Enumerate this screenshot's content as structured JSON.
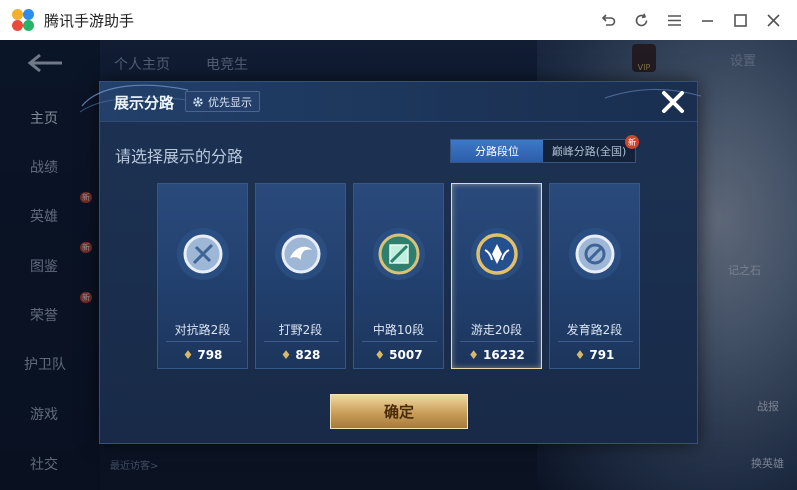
{
  "window": {
    "title": "腾讯手游助手",
    "controls": [
      "undo-icon",
      "refresh-icon",
      "menu-icon",
      "minimize-icon",
      "maximize-icon",
      "close-icon"
    ]
  },
  "background": {
    "tabs": [
      "个人主页",
      "电竞生"
    ],
    "settings_label": "设置",
    "vip_label": "VIP",
    "sidebar": [
      "主页",
      "战绩",
      "英雄",
      "图鉴",
      "荣誉",
      "护卫队",
      "游戏",
      "社交"
    ],
    "sidebar_new_badge": "新",
    "recent_visitors": "最近访客>",
    "right_labels": {
      "stone": "记之石",
      "battle": "战报",
      "swap": "换英雄"
    }
  },
  "modal": {
    "title": "展示分路",
    "priority_label": "优先显示",
    "subtitle": "请选择展示的分路",
    "toggle": {
      "option_active": "分路段位",
      "option_inactive": "巅峰分路(全国)",
      "new_badge": "新"
    },
    "lanes": [
      {
        "name": "对抗路2段",
        "score": "798",
        "selected": false,
        "emblem": "clash-lane-icon"
      },
      {
        "name": "打野2段",
        "score": "828",
        "selected": false,
        "emblem": "jungle-icon"
      },
      {
        "name": "中路10段",
        "score": "5007",
        "selected": false,
        "emblem": "mid-lane-icon"
      },
      {
        "name": "游走20段",
        "score": "16232",
        "selected": true,
        "emblem": "roam-icon"
      },
      {
        "name": "发育路2段",
        "score": "791",
        "selected": false,
        "emblem": "farm-lane-icon"
      }
    ],
    "confirm_label": "确定"
  },
  "colors": {
    "accent": "#2c5ea8",
    "gold": "#c99e59",
    "selected_border": "#e8d9b0"
  }
}
